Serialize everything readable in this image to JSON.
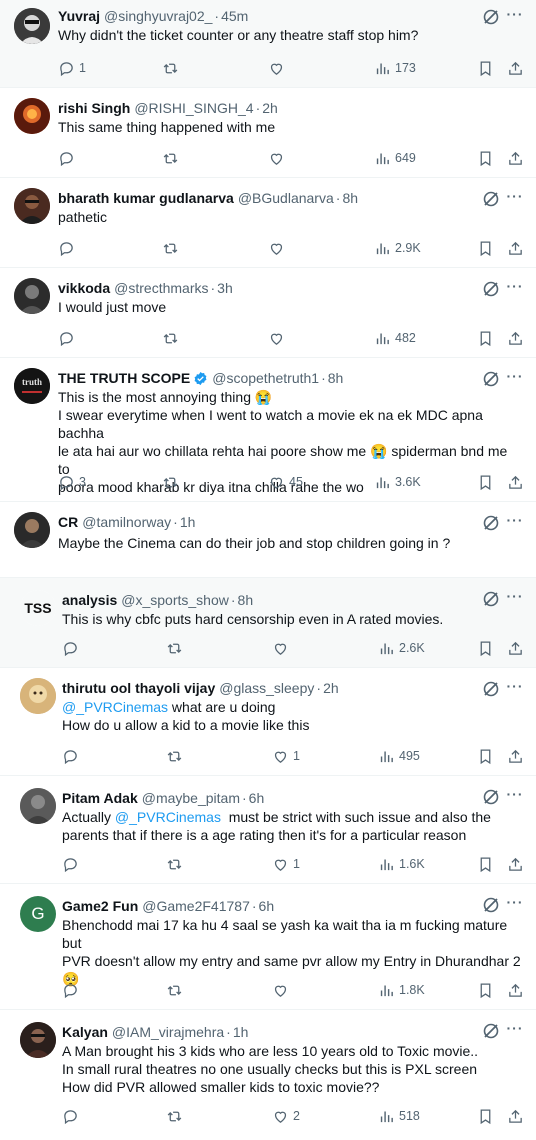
{
  "tweets": [
    {
      "name": "Yuvraj",
      "handle": "@singhyuvraj02_",
      "time": "45m",
      "text": "Why didn't the ticket counter or any theatre staff stop him?",
      "replies": "1",
      "retweets": "",
      "likes": "",
      "views": "173",
      "avatar_color": "#2b2b2b"
    },
    {
      "name": "rishi Singh",
      "handle": "@RISHI_SINGH_4",
      "time": "2h",
      "text": "This same thing happened with me",
      "replies": "",
      "retweets": "",
      "likes": "",
      "views": "649",
      "avatar_color": "#b3471b"
    },
    {
      "name": "bharath kumar gudlanarva",
      "handle": "@BGudlanarva",
      "time": "8h",
      "text": "pathetic",
      "replies": "",
      "retweets": "",
      "likes": "",
      "views": "2.9K",
      "avatar_color": "#3a1f1a"
    },
    {
      "name": "vikkoda",
      "handle": "@strecthmarks",
      "time": "3h",
      "text": "I would just move",
      "replies": "",
      "retweets": "",
      "likes": "",
      "views": "482",
      "avatar_color": "#4a4a4a"
    },
    {
      "name": "THE TRUTH SCOPE",
      "handle": "@scopethetruth1",
      "time": "8h",
      "text_lines": [
        "This is the most annoying thing 😭",
        "I swear everytime when I went to watch a movie ek na ek MDC apna bachha",
        "le ata hai aur wo chillata rehta hai poore show me 😭 spiderman bnd me to",
        "poora mood kharab kr diya itna chilla rahe the wo"
      ],
      "replies": "3",
      "retweets": "",
      "likes": "45",
      "views": "3.6K",
      "avatar_color": "#1c1c1c",
      "avatar_text": "truth"
    },
    {
      "name": "CR",
      "handle": "@tamilnorway",
      "time": "1h",
      "text": "Maybe the Cinema can do their job and stop children going in ?",
      "avatar_color": "#2e2e2e"
    },
    {
      "name": "analysis",
      "handle": "@x_sports_show",
      "time": "8h",
      "text": "This is why cbfc puts hard censorship even in A rated movies.",
      "replies": "",
      "retweets": "",
      "likes": "",
      "views": "2.6K",
      "avatar_color": "#ffffff",
      "avatar_text": "TSS"
    },
    {
      "name": "thirutu ool thayoli vijay",
      "handle": "@glass_sleepy",
      "time": "2h",
      "mention": "@_PVRCinemas",
      "text_after_mention": " what are u doing",
      "text2": "How do u allow a kid to a movie like this",
      "replies": "",
      "retweets": "",
      "likes": "1",
      "views": "495",
      "avatar_color": "#c9a368"
    },
    {
      "name": "Pitam Adak",
      "handle": "@maybe_pitam",
      "time": "6h",
      "text_before_mention": "Actually ",
      "mention": "@_PVRCinemas",
      "text_after_mention": "  must be strict with such issue and also the",
      "text2": "parents that if there is a age rating then it's for a particular reason",
      "replies": "",
      "retweets": "",
      "likes": "1",
      "views": "1.6K",
      "avatar_color": "#6b6b6b"
    },
    {
      "name": "Game2 Fun",
      "handle": "@Game2F41787",
      "time": "6h",
      "text_lines": [
        "Bhenchodd mai 17 ka hu 4 saal se yash ka wait tha ia m fucking mature but",
        "PVR doesn't allow my entry and same pvr allow my Entry in Dhurandhar 2",
        "🥺"
      ],
      "replies": "",
      "retweets": "",
      "likes": "",
      "views": "1.8K",
      "avatar_color": "#2e7d4f",
      "avatar_text": "G"
    },
    {
      "name": "Kalyan",
      "handle": "@IAM_virajmehra",
      "time": "1h",
      "text_lines": [
        "A Man brought his 3 kids who are less 10 years old to Toxic movie..",
        "In small rural theatres no one usually checks but this is PXL screen",
        "How did PVR allowed smaller kids to toxic movie??"
      ],
      "replies": "",
      "retweets": "",
      "likes": "2",
      "views": "518",
      "avatar_color": "#3d2b25"
    }
  ],
  "more_label": "···",
  "separator": "·"
}
